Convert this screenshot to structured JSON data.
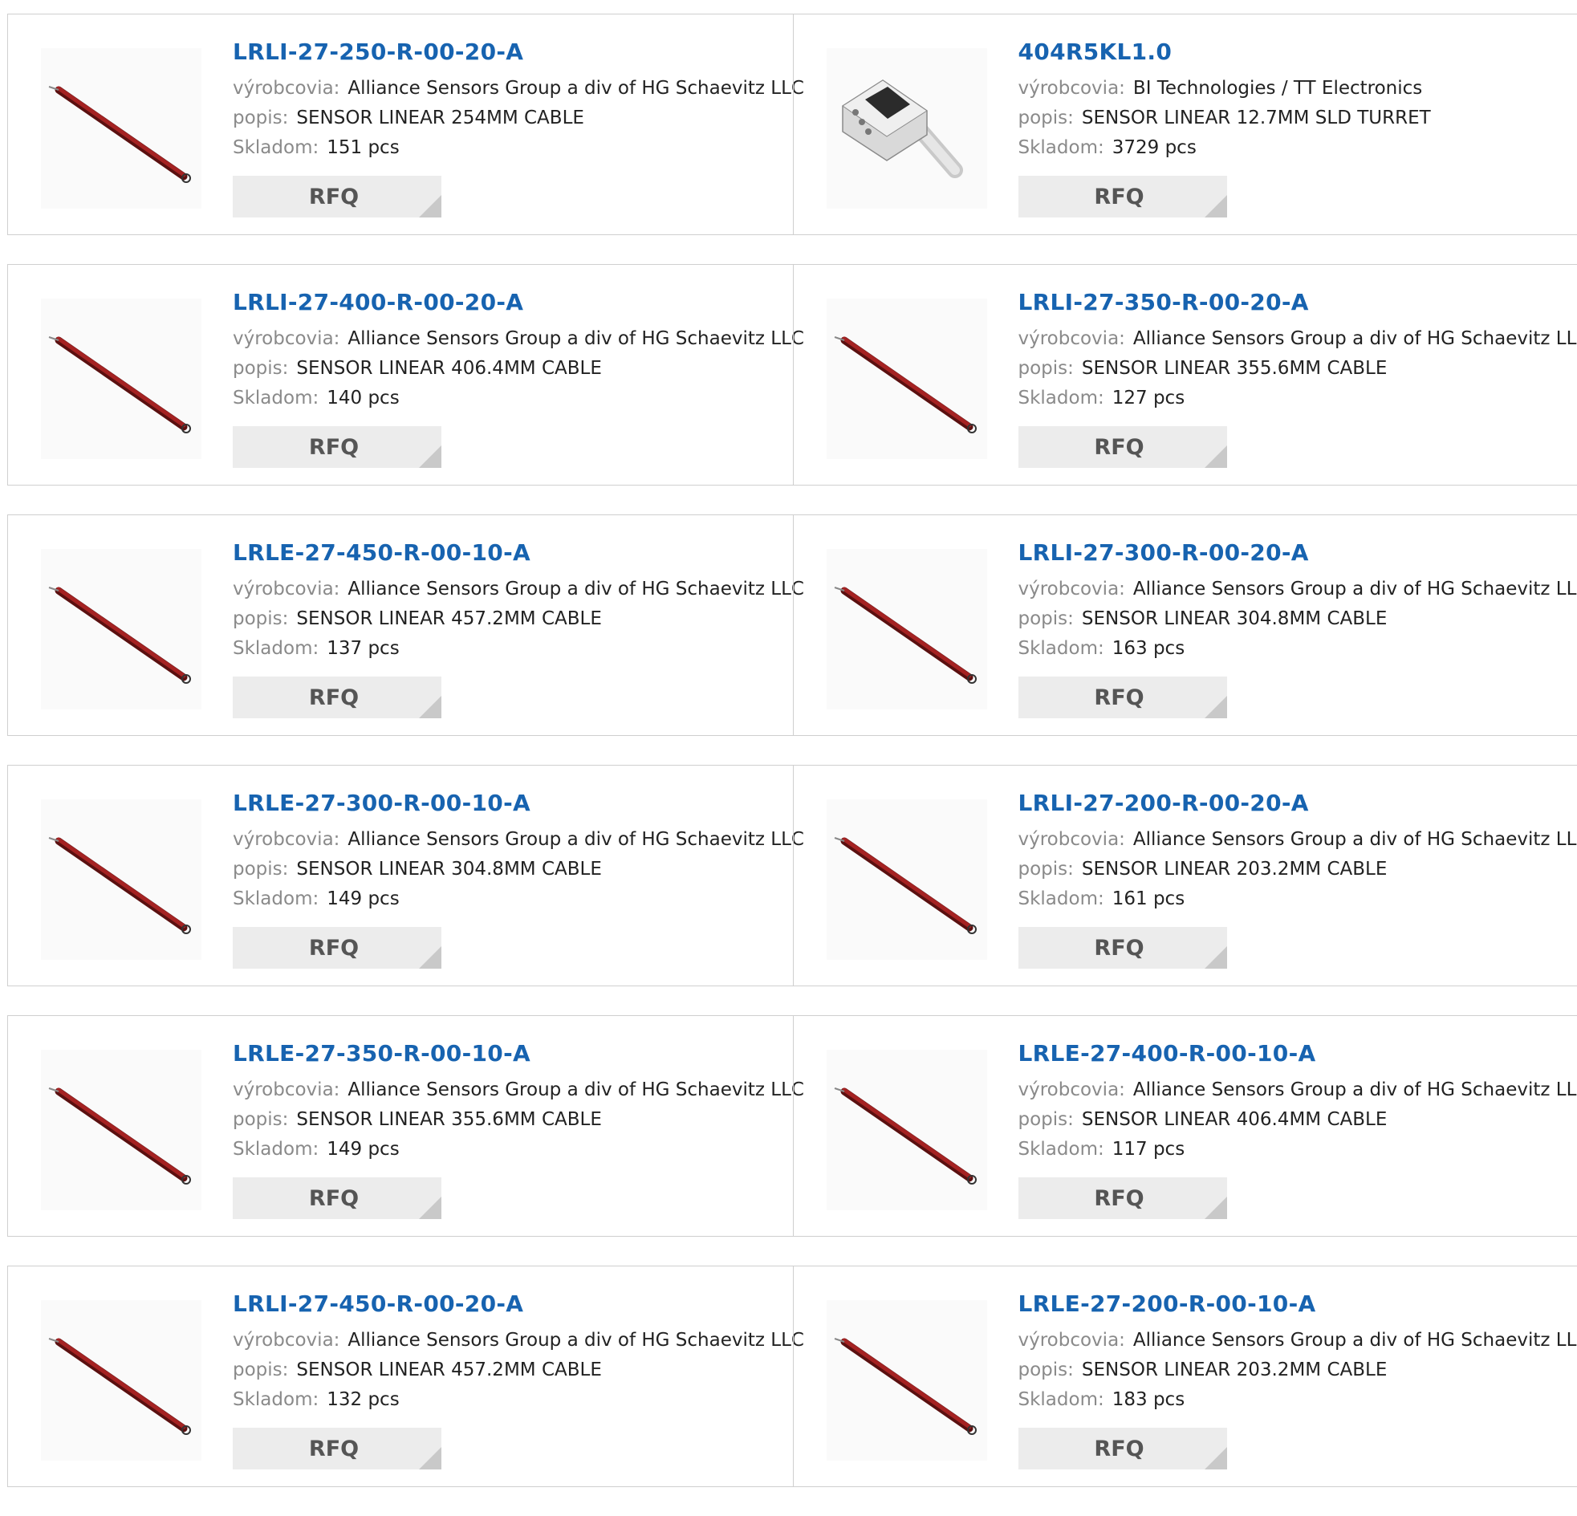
{
  "labels": {
    "manufacturer": "výrobcovia:",
    "description": "popis:",
    "stock": "Skladom:",
    "rfq": "RFQ"
  },
  "products": [
    {
      "pn": "LRLI-27-250-R-00-20-A",
      "mfr": "Alliance Sensors Group a div of HG Schaevitz LLC",
      "desc": "SENSOR LINEAR 254MM CABLE",
      "stock": "151 pcs",
      "image": "rod"
    },
    {
      "pn": "404R5KL1.0",
      "mfr": "BI Technologies / TT Electronics",
      "desc": "SENSOR LINEAR 12.7MM SLD TURRET",
      "stock": "3729 pcs",
      "image": "block"
    },
    {
      "pn": "LRLI-27-400-R-00-20-A",
      "mfr": "Alliance Sensors Group a div of HG Schaevitz LLC",
      "desc": "SENSOR LINEAR 406.4MM CABLE",
      "stock": "140 pcs",
      "image": "rod"
    },
    {
      "pn": "LRLI-27-350-R-00-20-A",
      "mfr": "Alliance Sensors Group a div of HG Schaevitz LLC",
      "desc": "SENSOR LINEAR 355.6MM CABLE",
      "stock": "127 pcs",
      "image": "rod"
    },
    {
      "pn": "LRLE-27-450-R-00-10-A",
      "mfr": "Alliance Sensors Group a div of HG Schaevitz LLC",
      "desc": "SENSOR LINEAR 457.2MM CABLE",
      "stock": "137 pcs",
      "image": "rod"
    },
    {
      "pn": "LRLI-27-300-R-00-20-A",
      "mfr": "Alliance Sensors Group a div of HG Schaevitz LLC",
      "desc": "SENSOR LINEAR 304.8MM CABLE",
      "stock": "163 pcs",
      "image": "rod"
    },
    {
      "pn": "LRLE-27-300-R-00-10-A",
      "mfr": "Alliance Sensors Group a div of HG Schaevitz LLC",
      "desc": "SENSOR LINEAR 304.8MM CABLE",
      "stock": "149 pcs",
      "image": "rod"
    },
    {
      "pn": "LRLI-27-200-R-00-20-A",
      "mfr": "Alliance Sensors Group a div of HG Schaevitz LLC",
      "desc": "SENSOR LINEAR 203.2MM CABLE",
      "stock": "161 pcs",
      "image": "rod"
    },
    {
      "pn": "LRLE-27-350-R-00-10-A",
      "mfr": "Alliance Sensors Group a div of HG Schaevitz LLC",
      "desc": "SENSOR LINEAR 355.6MM CABLE",
      "stock": "149 pcs",
      "image": "rod"
    },
    {
      "pn": "LRLE-27-400-R-00-10-A",
      "mfr": "Alliance Sensors Group a div of HG Schaevitz LLC",
      "desc": "SENSOR LINEAR 406.4MM CABLE",
      "stock": "117 pcs",
      "image": "rod"
    },
    {
      "pn": "LRLI-27-450-R-00-20-A",
      "mfr": "Alliance Sensors Group a div of HG Schaevitz LLC",
      "desc": "SENSOR LINEAR 457.2MM CABLE",
      "stock": "132 pcs",
      "image": "rod"
    },
    {
      "pn": "LRLE-27-200-R-00-10-A",
      "mfr": "Alliance Sensors Group a div of HG Schaevitz LLC",
      "desc": "SENSOR LINEAR 203.2MM CABLE",
      "stock": "183 pcs",
      "image": "rod"
    }
  ],
  "colors": {
    "link": "#1763b0",
    "rod": "#8b1a1a",
    "button_bg": "#ececec"
  }
}
